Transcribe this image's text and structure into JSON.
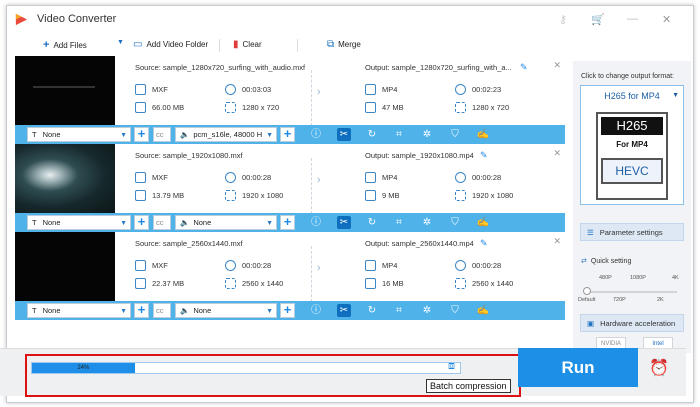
{
  "app": {
    "title": "Video Converter"
  },
  "toolbar": {
    "add_files": "Add Files",
    "add_video_folder": "Add Video Folder",
    "clear": "Clear",
    "merge": "Merge"
  },
  "files": [
    {
      "source": "Source: sample_1280x720_surfing_with_audio.mxf",
      "output": "Output: sample_1280x720_surfing_with_a...",
      "src_format": "MXF",
      "src_duration": "00:03:03",
      "src_size": "66.00 MB",
      "src_res": "1280 x 720",
      "out_format": "MP4",
      "out_duration": "00:02:23",
      "out_size": "47 MB",
      "out_res": "1280 x 720",
      "subtitle": "None",
      "audio": "pcm_s16le, 48000 H"
    },
    {
      "source": "Source: sample_1920x1080.mxf",
      "output": "Output: sample_1920x1080.mp4",
      "src_format": "MXF",
      "src_duration": "00:00:28",
      "src_size": "13.79 MB",
      "src_res": "1920 x 1080",
      "out_format": "MP4",
      "out_duration": "00:00:28",
      "out_size": "9 MB",
      "out_res": "1920 x 1080",
      "subtitle": "None",
      "audio": "None"
    },
    {
      "source": "Source: sample_2560x1440.mxf",
      "output": "Output: sample_2560x1440.mp4",
      "src_format": "MXF",
      "src_duration": "00:00:28",
      "src_size": "22.37 MB",
      "src_res": "2560 x 1440",
      "out_format": "MP4",
      "out_duration": "00:00:28",
      "out_size": "16 MB",
      "out_res": "2560 x 1440",
      "subtitle": "None",
      "audio": "None"
    }
  ],
  "panel": {
    "click_label": "Click to change output format:",
    "format": "H265 for MP4",
    "card_top": "H265",
    "card_mid": "For MP4",
    "card_bottom": "HEVC",
    "parameter_settings": "Parameter settings",
    "quick_setting": "Quick setting",
    "ticks_top": [
      "480P",
      "1080P",
      "4K"
    ],
    "ticks_bottom": [
      "Default",
      "720P",
      "2K"
    ],
    "hardware_acceleration": "Hardware acceleration",
    "nvidia": "NVIDIA",
    "intel": "Intel"
  },
  "progress": {
    "percent_label": "24%",
    "value": 0.24
  },
  "tooltip": "Batch compression",
  "run_label": "Run"
}
